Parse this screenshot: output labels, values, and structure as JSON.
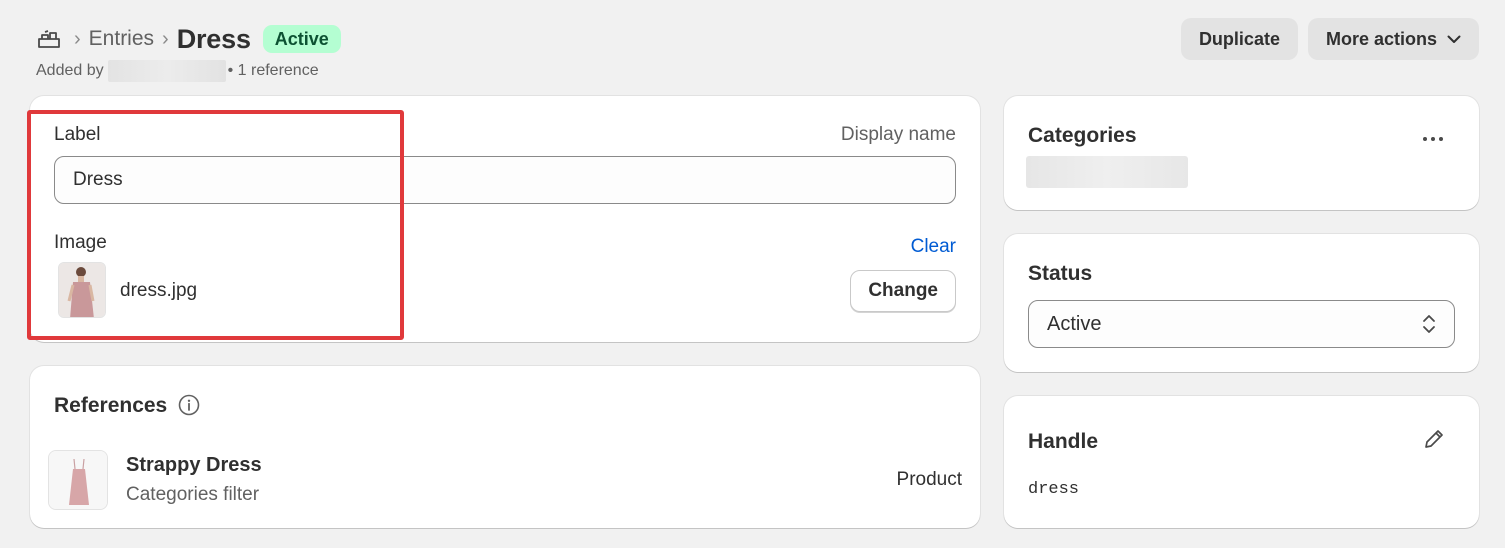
{
  "header": {
    "breadcrumb_icon": "metaobject-icon",
    "breadcrumb_parent": "Entries",
    "title": "Dress",
    "status_badge": "Active",
    "added_by_prefix": "Added by",
    "references_count": "• 1 reference",
    "actions": {
      "duplicate": "Duplicate",
      "more_actions": "More actions"
    }
  },
  "main": {
    "label_field": {
      "label": "Label",
      "hint": "Display name",
      "value": "Dress"
    },
    "image_field": {
      "label": "Image",
      "clear": "Clear",
      "filename": "dress.jpg",
      "change": "Change"
    }
  },
  "references": {
    "title": "References",
    "items": [
      {
        "name": "Strappy Dress",
        "subtitle": "Categories filter",
        "type": "Product"
      }
    ]
  },
  "categories": {
    "title": "Categories"
  },
  "status": {
    "title": "Status",
    "selected": "Active"
  },
  "handle": {
    "title": "Handle",
    "value": "dress"
  },
  "colors": {
    "badge_bg": "#b4fed2",
    "badge_text": "#0c5132",
    "link": "#005bd3",
    "highlight": "#e0393b"
  }
}
